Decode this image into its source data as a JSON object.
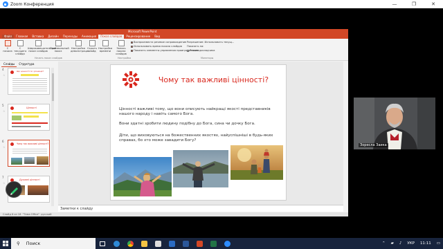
{
  "zoom": {
    "title": "Zoom Конференция"
  },
  "window": {
    "minimize": "—",
    "maximize": "❐",
    "close": "✕"
  },
  "ppt": {
    "title": "Microsoft PowerPoint",
    "tabs": [
      "Файл",
      "Главная",
      "Вставка",
      "Дизайн",
      "Переходы",
      "Анимация",
      "Показ слайдов",
      "Рецензирование",
      "Вид"
    ],
    "ribbon": {
      "buttons": [
        {
          "label": "С начала"
        },
        {
          "label": "С текущего слайда"
        },
        {
          "label": "Широковещательный показ слайдов"
        },
        {
          "label": "Произвольный показ"
        },
        {
          "label": "Настройка демонстрации"
        },
        {
          "label": "Скрыть слайд"
        },
        {
          "label": "Настройка времени"
        },
        {
          "label": "Запись показа слайдов"
        }
      ],
      "checks": [
        {
          "label": "Воспроизвести речевое сопровождение",
          "on": true
        },
        {
          "label": "Использовать время показа слайдов",
          "on": true
        },
        {
          "label": "Показать элементы управления проигрывателем",
          "on": true
        }
      ],
      "monitor": {
        "label_resolution": "Разрешение:",
        "value_resolution": "Использовать текущ...",
        "label_show": "Показать на:",
        "presenter": "Режим докладчика"
      },
      "groups": [
        "Начать показ слайдов",
        "Настройка",
        "Мониторы"
      ]
    },
    "pane_tabs": [
      "Слайды",
      "Структура"
    ],
    "thumbs": [
      {
        "num": "4",
        "title": "Що цінності їх і різниця?"
      },
      {
        "num": "5",
        "title": "Цінності"
      },
      {
        "num": "6",
        "title": "Чому так важливі цінності?"
      },
      {
        "num": "7",
        "title": "Духовні цінності"
      }
    ],
    "slide": {
      "title": "Чому так важливі цінності?",
      "p1": "Цінності важливі тому, що вони описують найкращі якості представників нашого народу і навіть самого Бога.",
      "p2": "Вони здатні зробити людину подібну до Бога, сина чи дочку Бога.",
      "p3": "Діти, що виховуються на божественних якостях, найуспішніші в будь-яких справах, бо хто може завадити Богу?"
    },
    "notes_placeholder": "Заметки к слайду",
    "status": {
      "slide": "Слайд 6 из 18",
      "theme": "\"Тема Office\"",
      "lang": "русский"
    }
  },
  "video": {
    "name": "Зоресла Заика"
  },
  "taskbar": {
    "search_placeholder": "Поиск",
    "lang": "УКР",
    "time": "11:11"
  },
  "colors": {
    "accent": "#d24726",
    "slide_title": "#d9281e",
    "taskbar": "#18243d"
  }
}
